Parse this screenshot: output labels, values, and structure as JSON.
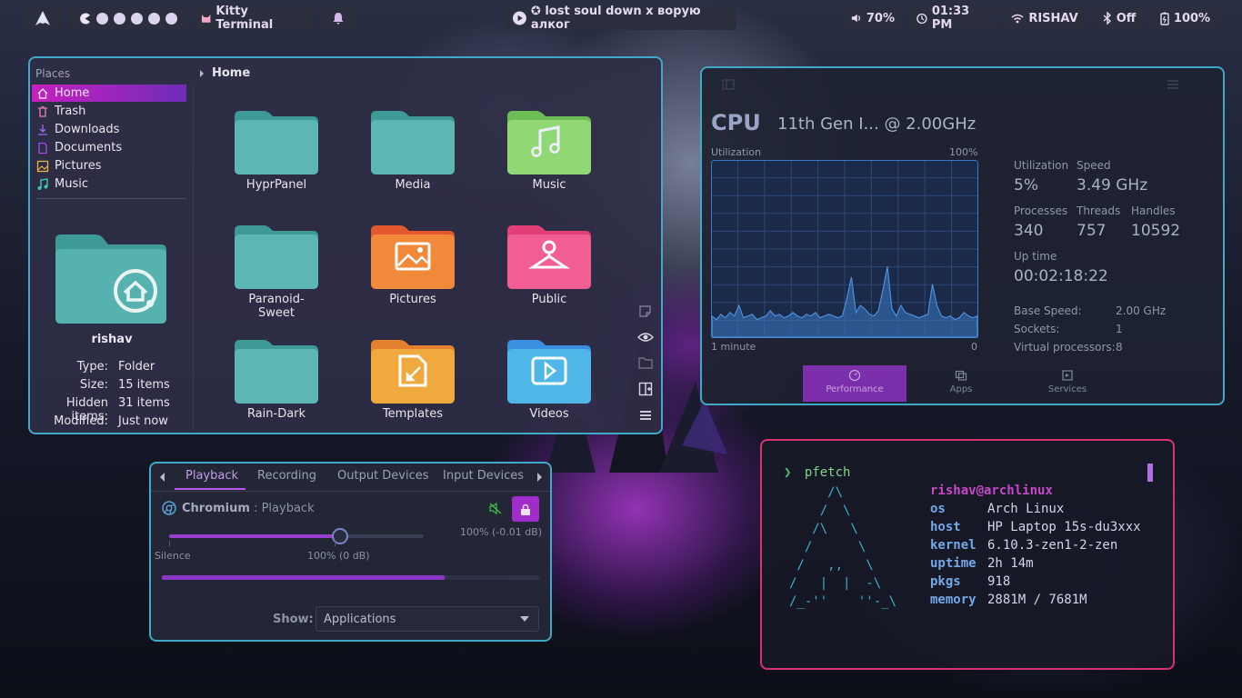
{
  "topbar": {
    "kitty": "Kitty Terminal",
    "media": "✪ lost soul down x ворую алког",
    "volume": "70%",
    "clock": "01:33 PM",
    "network": "RISHAV",
    "bluetooth": "Off",
    "battery": "100%"
  },
  "filemanager": {
    "breadcrumb": "Home",
    "places_title": "Places",
    "places": [
      {
        "label": "Home",
        "icon": "home-icon"
      },
      {
        "label": "Trash",
        "icon": "trash-icon"
      },
      {
        "label": "Downloads",
        "icon": "download-icon"
      },
      {
        "label": "Documents",
        "icon": "document-icon"
      },
      {
        "label": "Pictures",
        "icon": "picture-icon"
      },
      {
        "label": "Music",
        "icon": "music-icon"
      }
    ],
    "info": {
      "name": "rishav",
      "rows": [
        {
          "k": "Type:",
          "v": "Folder"
        },
        {
          "k": "Size:",
          "v": "15 items"
        },
        {
          "k": "Hidden items:",
          "v": "31 items"
        },
        {
          "k": "Modified:",
          "v": "Just now"
        }
      ]
    },
    "folders": [
      {
        "label": "HyprPanel",
        "color": "teal"
      },
      {
        "label": "Media",
        "color": "teal"
      },
      {
        "label": "Music",
        "color": "green"
      },
      {
        "label": "Paranoid-Sweet",
        "color": "teal"
      },
      {
        "label": "Pictures",
        "color": "orange"
      },
      {
        "label": "Public",
        "color": "pink"
      },
      {
        "label": "Rain-Dark",
        "color": "teal"
      },
      {
        "label": "Templates",
        "color": "amber"
      },
      {
        "label": "Videos",
        "color": "blue"
      }
    ]
  },
  "taskmanager": {
    "title": "CPU",
    "cpu_name": "11th Gen I... @ 2.00GHz",
    "util_label": "Utilization",
    "util_max": "100%",
    "graph_left": "1 minute",
    "graph_right": "0",
    "stats": [
      {
        "k": "Utilization",
        "v": "5%"
      },
      {
        "k": "Speed",
        "v": "3.49 GHz"
      },
      {
        "k": "Processes",
        "v": "340"
      },
      {
        "k": "Threads",
        "v": "757"
      },
      {
        "k": "Handles",
        "v": "10592"
      },
      {
        "k": "Up time",
        "v": "00:02:18:22"
      }
    ],
    "details": [
      {
        "k": "Base Speed:",
        "v": "2.00 GHz"
      },
      {
        "k": "Sockets:",
        "v": "1"
      },
      {
        "k": "Virtual processors:",
        "v": "8"
      }
    ],
    "tabs": [
      "Performance",
      "Apps",
      "Services"
    ],
    "graph_series": [
      12,
      10,
      13,
      11,
      14,
      12,
      18,
      11,
      12,
      13,
      10,
      11,
      12,
      15,
      12,
      13,
      11,
      12,
      14,
      12,
      11,
      13,
      12,
      14,
      11,
      12,
      13,
      12,
      11,
      12,
      22,
      34,
      14,
      18,
      16,
      13,
      12,
      15,
      27,
      40,
      16,
      12,
      18,
      14,
      13,
      12,
      11,
      12,
      13,
      30,
      18,
      12,
      11,
      12,
      10,
      11,
      14,
      12,
      11,
      12
    ]
  },
  "pavucontrol": {
    "tabs": [
      "Playback",
      "Recording",
      "Output Devices",
      "Input Devices"
    ],
    "app": "Chromium",
    "app_suffix": " : Playback",
    "level_right": "100% (-0.01 dB)",
    "mark_silence": "Silence",
    "mark_100": "100% (0 dB)",
    "slider_level": 0.67,
    "meter_level": 0.75,
    "show_label": "Show:",
    "show_value": "Applications"
  },
  "terminal": {
    "prompt": "❯",
    "command": "pfetch",
    "user": "rishav@archlinux",
    "art": [
      "     /\\",
      "    /  \\",
      "   /\\   \\",
      "  /      \\",
      " /   ,,   \\",
      "/   |  |  -\\",
      "/_-''    ''-_\\"
    ],
    "rows": [
      {
        "k": "os",
        "v": "Arch Linux"
      },
      {
        "k": "host",
        "v": "HP Laptop 15s-du3xxx"
      },
      {
        "k": "kernel",
        "v": "6.10.3-zen1-2-zen"
      },
      {
        "k": "uptime",
        "v": "2h 14m"
      },
      {
        "k": "pkgs",
        "v": "918"
      },
      {
        "k": "memory",
        "v": "2881M / 7681M"
      }
    ]
  }
}
